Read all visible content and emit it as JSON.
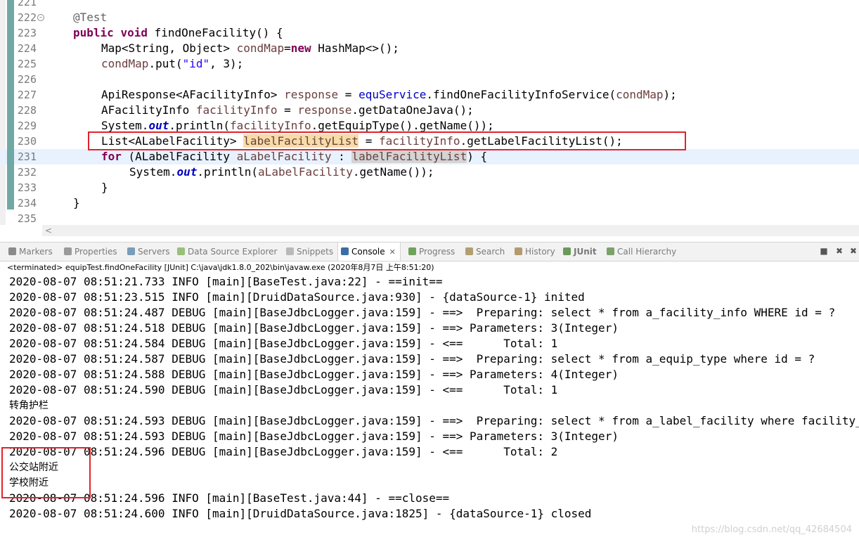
{
  "editor": {
    "lines": [
      {
        "num": "221",
        "code": ""
      },
      {
        "num": "222",
        "annotation": "@Test"
      },
      {
        "num": "223",
        "kw1": "public",
        "kw2": "void",
        "rest": " findOneFacility() {"
      },
      {
        "num": "224",
        "a": "Map<String, Object> ",
        "var": "condMap",
        "b": "=",
        "kw": "new",
        "c": " HashMap<>();"
      },
      {
        "num": "225",
        "var": "condMap",
        "a": ".put(",
        "str": "\"id\"",
        "b": ", 3);"
      },
      {
        "num": "226"
      },
      {
        "num": "227",
        "a": "ApiResponse<AFacilityInfo> ",
        "var": "response",
        "b": " = ",
        "fld": "equService",
        "c": ".findOneFacilityInfoService(",
        "var2": "condMap",
        "d": ");"
      },
      {
        "num": "228",
        "a": "AFacilityInfo ",
        "var": "facilityInfo",
        "b": " = ",
        "var2": "response",
        "c": ".getDataOneJava();"
      },
      {
        "num": "229",
        "a": "System.",
        "sfld": "out",
        "b": ".println(",
        "var": "facilityInfo",
        "c": ".getEquipType().getName());"
      },
      {
        "num": "230",
        "a": "List<ALabelFacility> ",
        "var": "labelFacilityList",
        "b": " = ",
        "var2": "facilityInfo",
        "c": ".getLabelFacilityList();"
      },
      {
        "num": "231",
        "kw": "for",
        "a": " (ALabelFacility ",
        "var": "aLabelFacility",
        "b": " : ",
        "var2": "labelFacilityList",
        "c": ") {"
      },
      {
        "num": "232",
        "a": "System.",
        "sfld": "out",
        "b": ".println(",
        "var": "aLabelFacility",
        "c": ".getName());"
      },
      {
        "num": "233",
        "a": "}"
      },
      {
        "num": "234",
        "a": "}"
      },
      {
        "num": "235"
      }
    ]
  },
  "tabs": [
    {
      "label": "Markers",
      "icon": "markers-icon",
      "color": "#8a8a8a"
    },
    {
      "label": "Properties",
      "icon": "properties-icon",
      "color": "#9a9a9a"
    },
    {
      "label": "Servers",
      "icon": "servers-icon",
      "color": "#7b9db8"
    },
    {
      "label": "Data Source Explorer",
      "icon": "data-source-icon",
      "color": "#9bbf7a"
    },
    {
      "label": "Snippets",
      "icon": "snippets-icon",
      "color": "#b9b9b9"
    },
    {
      "label": "Console",
      "icon": "console-icon",
      "color": "#3b6ea5",
      "close": "✕"
    },
    {
      "label": "Progress",
      "icon": "progress-icon",
      "color": "#6fa35a"
    },
    {
      "label": "Search",
      "icon": "search-icon",
      "color": "#b0a070"
    },
    {
      "label": "History",
      "icon": "history-icon",
      "color": "#b49a6e"
    },
    {
      "label": "JUnit",
      "icon": "junit-icon",
      "color": "#6a9a5a"
    },
    {
      "label": "Call Hierarchy",
      "icon": "call-hierarchy-icon",
      "color": "#7aa26a"
    }
  ],
  "console": {
    "terminated": "<terminated> equipTest.findOneFacility [JUnit] C:\\java\\jdk1.8.0_202\\bin\\javaw.exe (2020年8月7日 上午8:51:20)",
    "lines": [
      "2020-08-07 08:51:21.733 INFO [main][BaseTest.java:22] - ==init==",
      "2020-08-07 08:51:23.515 INFO [main][DruidDataSource.java:930] - {dataSource-1} inited",
      "2020-08-07 08:51:24.487 DEBUG [main][BaseJdbcLogger.java:159] - ==>  Preparing: select * from a_facility_info WHERE id = ?",
      "2020-08-07 08:51:24.518 DEBUG [main][BaseJdbcLogger.java:159] - ==> Parameters: 3(Integer)",
      "2020-08-07 08:51:24.584 DEBUG [main][BaseJdbcLogger.java:159] - <==      Total: 1",
      "2020-08-07 08:51:24.587 DEBUG [main][BaseJdbcLogger.java:159] - ==>  Preparing: select * from a_equip_type where id = ?",
      "2020-08-07 08:51:24.588 DEBUG [main][BaseJdbcLogger.java:159] - ==> Parameters: 4(Integer)",
      "2020-08-07 08:51:24.590 DEBUG [main][BaseJdbcLogger.java:159] - <==      Total: 1",
      "转角护栏",
      "2020-08-07 08:51:24.593 DEBUG [main][BaseJdbcLogger.java:159] - ==>  Preparing: select * from a_label_facility where facility_id = ?",
      "2020-08-07 08:51:24.593 DEBUG [main][BaseJdbcLogger.java:159] - ==> Parameters: 3(Integer)",
      "2020-08-07 08:51:24.596 DEBUG [main][BaseJdbcLogger.java:159] - <==      Total: 2",
      "公交站附近",
      "学校附近",
      "2020-08-07 08:51:24.596 INFO [main][BaseTest.java:44] - ==close==",
      "2020-08-07 08:51:24.600 INFO [main][DruidDataSource.java:1825] - {dataSource-1} closed"
    ]
  },
  "watermark": "https://blog.csdn.net/qq_42684504"
}
